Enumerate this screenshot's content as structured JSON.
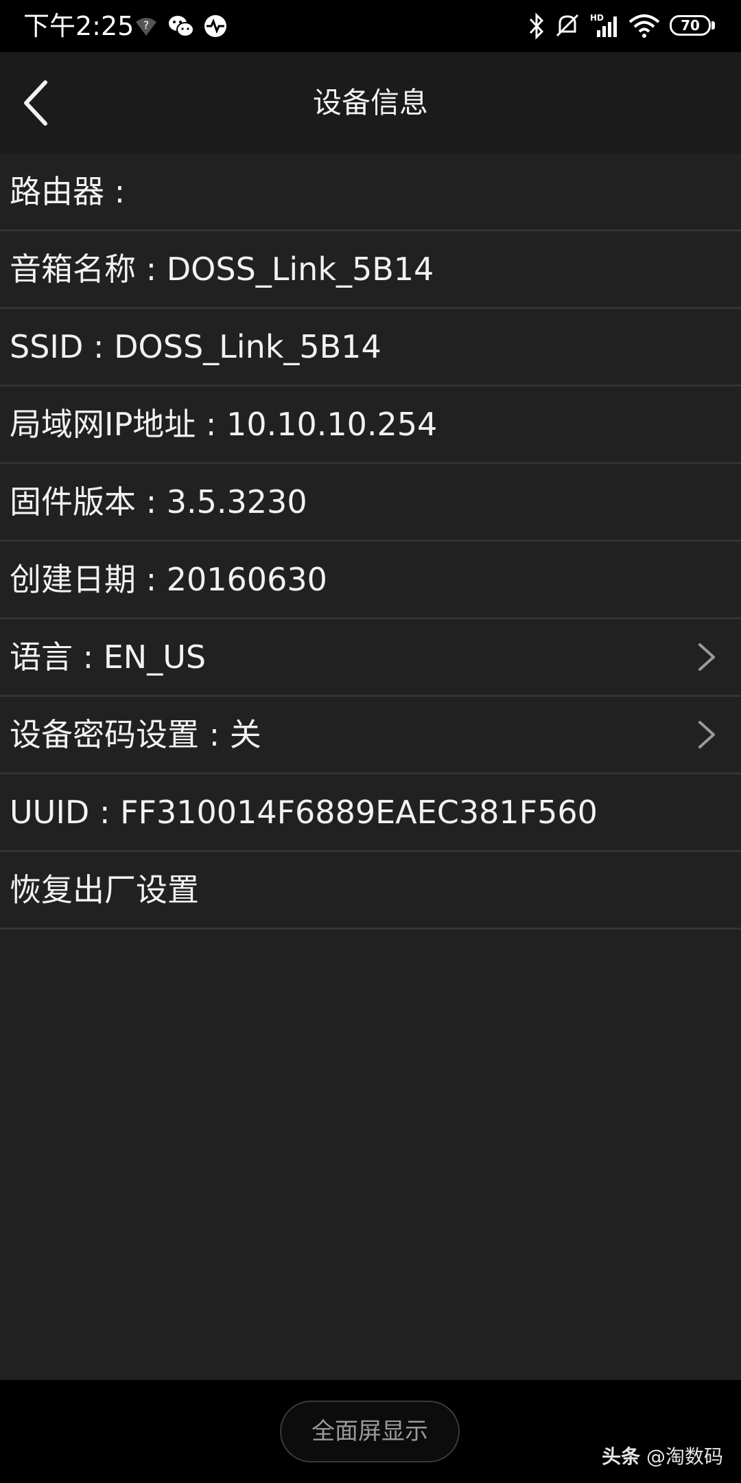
{
  "status_bar": {
    "time": "下午2:25",
    "battery": "70",
    "icons": [
      "wifi-question-icon",
      "wechat-icon",
      "activity-icon",
      "bluetooth-icon",
      "mute-icon",
      "hd-signal-icon",
      "wifi-icon",
      "battery-icon"
    ]
  },
  "header": {
    "back_icon": "chevron-left-icon",
    "title": "设备信息"
  },
  "rows": [
    {
      "text": "路由器 :"
    },
    {
      "text": "音箱名称 : DOSS_Link_5B14"
    },
    {
      "text": "SSID : DOSS_Link_5B14"
    },
    {
      "text": "局域网IP地址 : 10.10.10.254"
    },
    {
      "text": "固件版本 : 3.5.3230"
    },
    {
      "text": "创建日期 : 20160630"
    },
    {
      "text": "语言 : EN_US",
      "icon": "chevron-right-icon"
    },
    {
      "text": "设备密码设置 : 关",
      "icon": "chevron-right-icon"
    },
    {
      "text": "UUID : FF310014F6889EAEC381F560"
    },
    {
      "text": "恢复出厂设置"
    }
  ],
  "bottom_bar": {
    "fullscreen_label": "全面屏显示",
    "watermark_brand": "头条",
    "watermark_handle": "@淘数码"
  },
  "colors": {
    "background": "#212121",
    "header": "#1b1b1b",
    "status_bar": "#000000",
    "divider": "#333333",
    "text": "#f2f2f2"
  }
}
